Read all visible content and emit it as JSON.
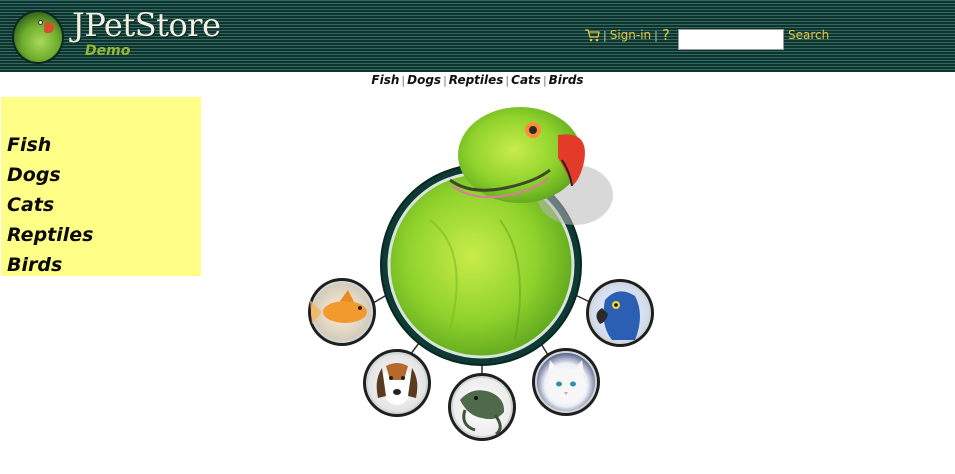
{
  "header": {
    "logo_title": "JPetStore",
    "logo_subtitle": "Demo",
    "signin_label": "Sign-in",
    "help_label": "?",
    "menu_separator": "|",
    "search_value": "",
    "search_button_label": "Search"
  },
  "quick_links": {
    "items": [
      "Fish",
      "Dogs",
      "Reptiles",
      "Cats",
      "Birds"
    ],
    "separator": "|"
  },
  "sidebar": {
    "items": [
      "Fish",
      "Dogs",
      "Cats",
      "Reptiles",
      "Birds"
    ]
  },
  "main_image": {
    "center": "bird-parrot",
    "thumbnails": [
      "fish",
      "dog",
      "reptile",
      "cat",
      "bird"
    ]
  },
  "colors": {
    "header_bg": "#1b4a44",
    "link_gold": "#e8c63e",
    "sidebar_bg": "#ffff88",
    "logo_subtitle": "#94b834"
  }
}
